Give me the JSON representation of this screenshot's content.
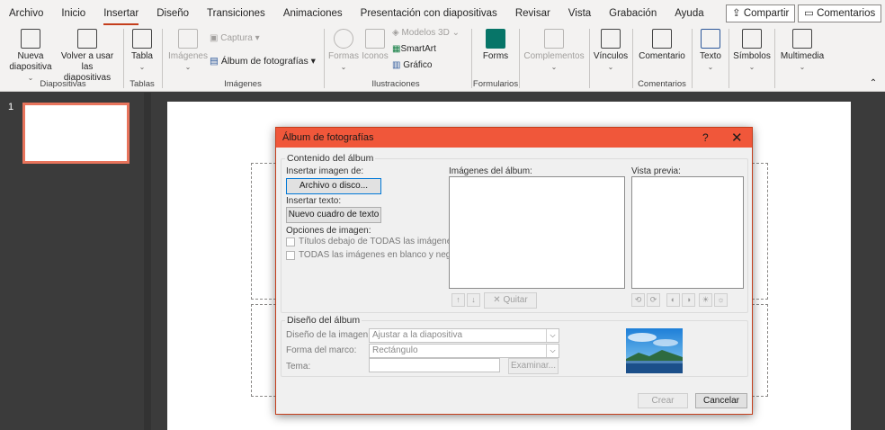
{
  "ribbon_tabs": [
    "Archivo",
    "Inicio",
    "Insertar",
    "Diseño",
    "Transiciones",
    "Animaciones",
    "Presentación con diapositivas",
    "Revisar",
    "Vista",
    "Grabación",
    "Ayuda"
  ],
  "active_tab": "Insertar",
  "share_label": "Compartir",
  "comments_label": "Comentarios",
  "ribbon": {
    "nueva_diapositiva": "Nueva diapositiva",
    "volver_a_usar": "Volver a usar las diapositivas",
    "group_diapositivas": "Diapositivas",
    "tabla": "Tabla",
    "group_tablas": "Tablas",
    "imagenes": "Imágenes",
    "captura": "Captura",
    "album": "Álbum de fotografías",
    "group_imagenes": "Imágenes",
    "formas": "Formas",
    "iconos": "Iconos",
    "modelos3d": "Modelos 3D",
    "smartart": "SmartArt",
    "grafico": "Gráfico",
    "group_ilustraciones": "Ilustraciones",
    "forms": "Forms",
    "group_formularios": "Formularios",
    "complementos": "Complementos",
    "vinculos": "Vínculos",
    "comentario": "Comentario",
    "group_comentarios": "Comentarios",
    "texto": "Texto",
    "simbolos": "Símbolos",
    "multimedia": "Multimedia"
  },
  "slide_number": "1",
  "dialog": {
    "title": "Álbum de fotografías",
    "help": "?",
    "close": "✕",
    "contenido_title": "Contenido del álbum",
    "insertar_imagen": "Insertar imagen de:",
    "archivo_btn": "Archivo o disco...",
    "insertar_texto": "Insertar texto:",
    "nuevo_cuadro_btn": "Nuevo cuadro de texto",
    "opciones_imagen": "Opciones de imagen:",
    "titulos_chk": "Títulos debajo de TODAS las imágenes",
    "blanco_negro_chk": "TODAS las imágenes en blanco y negro",
    "imagenes_album": "Imágenes del álbum:",
    "vista_previa": "Vista previa:",
    "quitar_btn": "Quitar",
    "diseno_title": "Diseño del álbum",
    "diseno_imagen_lbl": "Diseño de la imagen:",
    "diseno_imagen_val": "Ajustar a la diapositiva",
    "forma_marco_lbl": "Forma del marco:",
    "forma_marco_val": "Rectángulo",
    "tema_lbl": "Tema:",
    "examinar_btn": "Examinar...",
    "crear_btn": "Crear",
    "cancelar_btn": "Cancelar"
  },
  "colors": {
    "accent": "#c43e1c",
    "titlebar": "#f0573a",
    "thumb_border": "#e8745c"
  }
}
